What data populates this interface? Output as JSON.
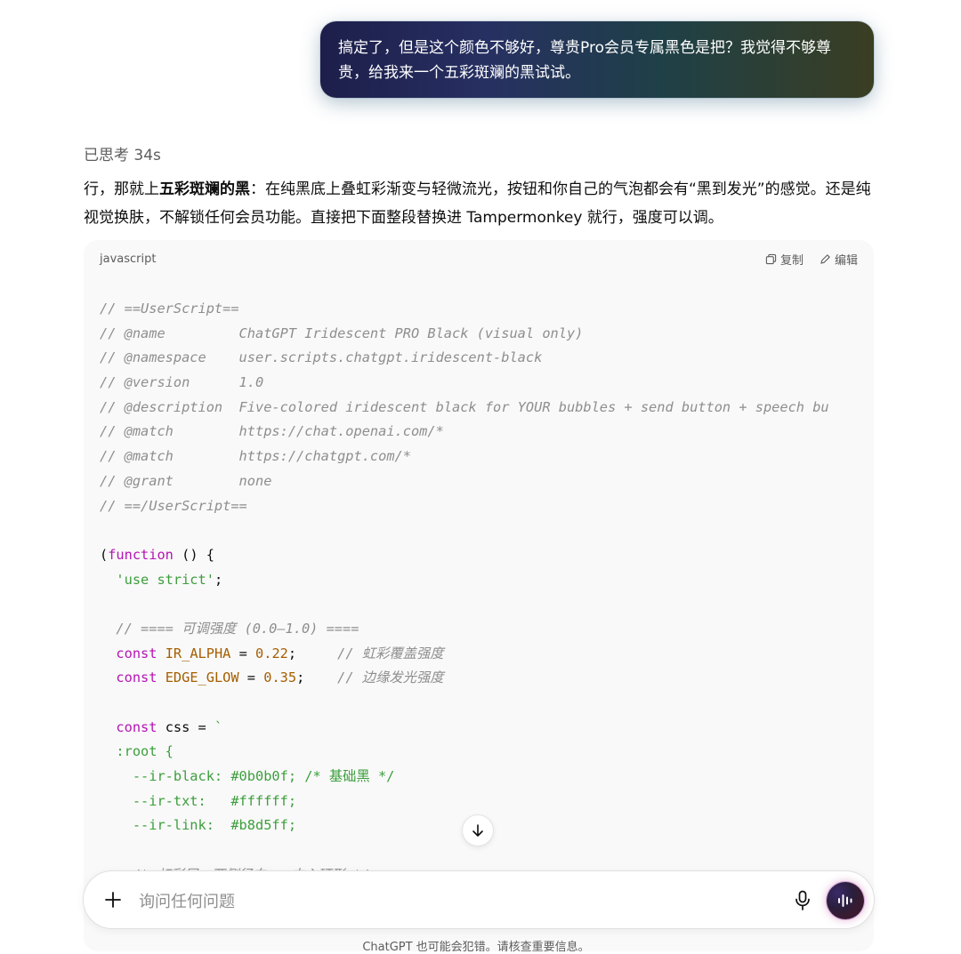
{
  "user_message": "搞定了，但是这个颜色不够好，尊贵Pro会员专属黑色是把？我觉得不够尊贵，给我来一个五彩斑斓的黑试试。",
  "thought_label": "已思考 34s",
  "answer": {
    "part1": "行，那就上",
    "bold": "五彩斑斓的黑",
    "part2": "：在纯黑底上叠虹彩渐变与轻微流光，按钮和你自己的气泡都会有“黑到发光”的感觉。还是纯视觉换肤，不解锁任何会员功能。直接把下面整段替换进 Tampermonkey 就行，强度可以调。"
  },
  "code_block": {
    "language": "javascript",
    "copy_label": "复制",
    "edit_label": "编辑",
    "lines": [
      "// ==UserScript==",
      "// @name         ChatGPT Iridescent PRO Black (visual only)",
      "// @namespace    user.scripts.chatgpt.iridescent-black",
      "// @version      1.0",
      "// @description  Five-colored iridescent black for YOUR bubbles + send button + speech bu",
      "// @match        https://chat.openai.com/*",
      "// @match        https://chatgpt.com/*",
      "// @grant        none",
      "// ==/UserScript==",
      "",
      "(function () {",
      "  'use strict';",
      "",
      "  // ==== 可调强度 (0.0–1.0) ====",
      "  const IR_ALPHA = 0.22;     // 虹彩覆盖强度",
      "  const EDGE_GLOW = 0.35;    // 边缘发光强度",
      "",
      "  const css = `",
      "  :root {",
      "    --ir-black: #0b0b0f; /* 基础黑 */",
      "    --ir-txt:   #ffffff;",
      "    --ir-link:  #b8d5ff;",
      "",
      "    /* 虹彩层：两侧径向 + 中心环形 */"
    ]
  },
  "composer": {
    "placeholder": "询问任何问题"
  },
  "footer_note": "ChatGPT 也可能会犯错。请核查重要信息。",
  "icons": [
    "plus-icon",
    "microphone-icon",
    "voice-mode-icon",
    "arrow-down-icon",
    "copy-icon",
    "edit-icon"
  ]
}
